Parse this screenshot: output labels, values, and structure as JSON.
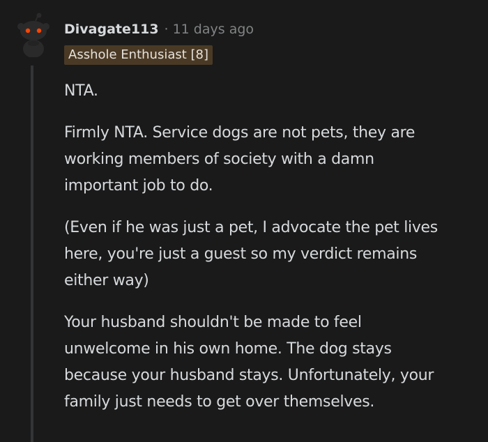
{
  "comment": {
    "author": "Divagate113",
    "separator": "·",
    "timestamp": "11 days ago",
    "flair": "Asshole Enthusiast [8]",
    "paragraphs": [
      {
        "lines": [
          "NTA."
        ]
      },
      {
        "lines": [
          "Firmly NTA. Service dogs are not pets, they are",
          "working members of society with a damn",
          "important job to do."
        ]
      },
      {
        "lines": [
          "(Even if he was just a pet, I advocate the pet lives",
          "here, you're just a guest so my verdict remains",
          "either way)"
        ]
      },
      {
        "lines": [
          "Your husband shouldn't be made to feel",
          "unwelcome in his own home. The dog stays",
          "because your husband stays. Unfortunately, your",
          "family just needs to get over themselves."
        ]
      }
    ]
  },
  "colors": {
    "background": "#1a1a1b",
    "text": "#d7dadc",
    "meta": "#818384",
    "flair_bg": "#4a3a25",
    "thread_line": "#343536",
    "avatar_eye": "#ff4500"
  },
  "icons": {
    "avatar": "snoo-avatar-icon"
  }
}
